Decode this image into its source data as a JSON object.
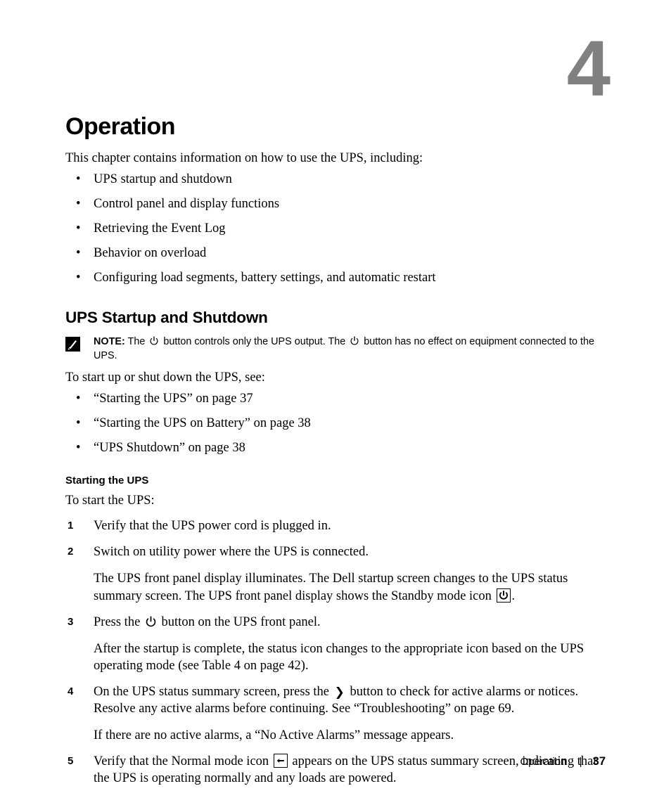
{
  "chapter": {
    "number": "4",
    "title": "Operation",
    "intro": "This chapter contains information on how to use the UPS, including:",
    "topics": [
      "UPS startup and shutdown",
      "Control panel and display functions",
      "Retrieving the Event Log",
      "Behavior on overload",
      "Configuring load segments, battery settings, and automatic restart"
    ]
  },
  "section": {
    "title": "UPS Startup and Shutdown",
    "note": {
      "icon": "note-pen-icon",
      "label": "NOTE:",
      "part1": "The",
      "part2": "button controls only the UPS output. The",
      "part3": "button has no effect on equipment connected to the UPS."
    },
    "lead_in": "To start up or shut down the UPS, see:",
    "crossrefs": [
      "“Starting the UPS” on page 37",
      "“Starting the UPS on Battery” on page 38",
      "“UPS Shutdown” on page 38"
    ]
  },
  "subsection": {
    "title": "Starting the UPS",
    "lead_in": "To start the UPS:",
    "steps": [
      {
        "num": "1",
        "text": "Verify that the UPS power cord is plugged in."
      },
      {
        "num": "2",
        "text": "Switch on utility power where the UPS is connected.",
        "sub_a": "The UPS front panel display illuminates. The Dell startup screen changes to the UPS status summary screen. The UPS front panel display shows the Standby mode icon",
        "sub_b": ".",
        "sub_icon": "standby-mode-icon"
      },
      {
        "num": "3",
        "text_a": "Press the",
        "text_b": "button on the UPS front panel.",
        "text_icon": "power-button-icon",
        "sub_a": "After the startup is complete, the status icon changes to the appropriate icon based on the UPS operating mode (see Table 4 on page 42)."
      },
      {
        "num": "4",
        "text_a": "On the UPS status summary screen, press the",
        "text_b": "button to check for active alarms or notices. Resolve any active alarms before continuing. See “Troubleshooting” on page 69.",
        "text_icon": "right-arrow-button-icon",
        "sub_a": "If there are no active alarms, a “No Active Alarms” message appears."
      },
      {
        "num": "5",
        "text_a": "Verify that the Normal mode icon",
        "text_b": "appears on the UPS status summary screen, indicating that the UPS is operating normally and any loads are powered.",
        "text_icon": "normal-mode-plug-icon"
      }
    ]
  },
  "footer": {
    "chapter_name": "Operation",
    "separator": "|",
    "page_number": "37"
  },
  "colors": {
    "chapter_number_gray": "#808080",
    "text_black": "#000000",
    "page_background": "#ffffff"
  }
}
